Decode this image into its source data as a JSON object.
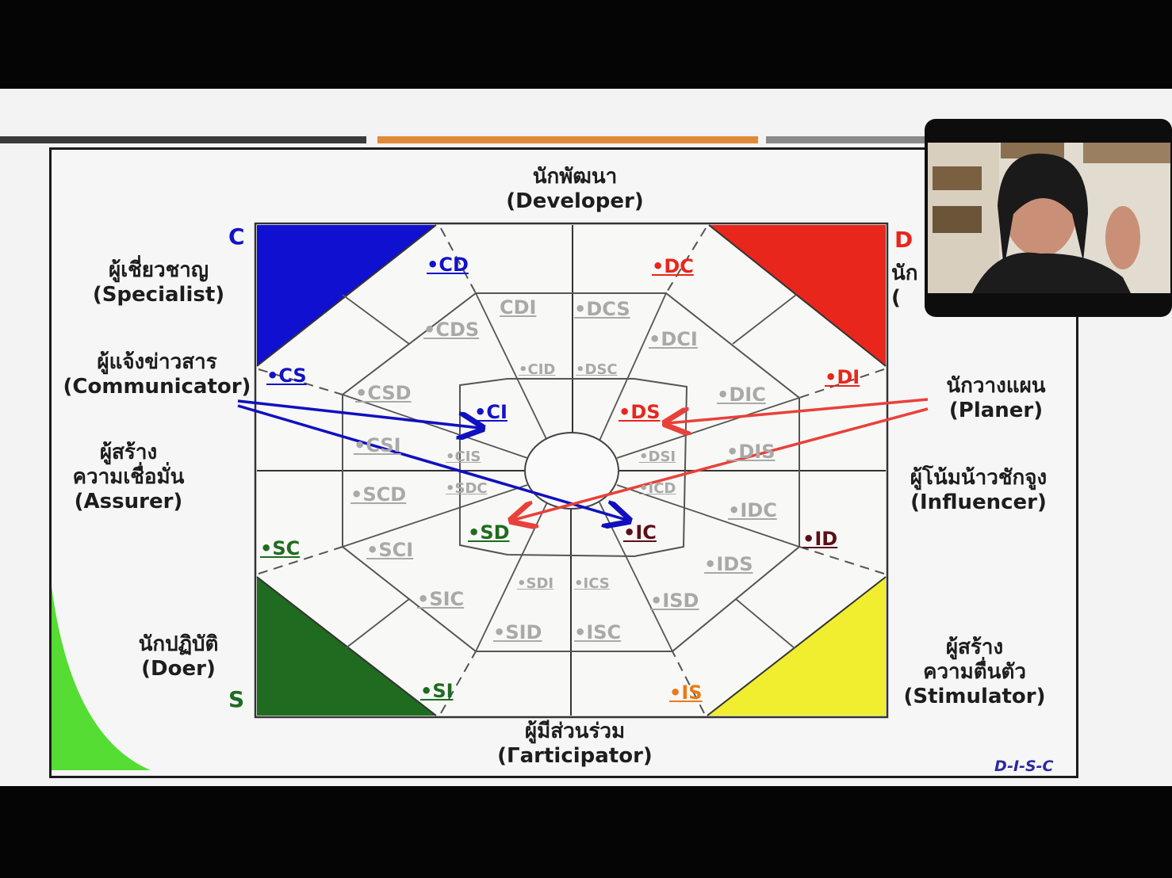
{
  "top_title": {
    "thai": "นักพัฒนา",
    "en": "(Developer)"
  },
  "bottom_title": {
    "thai": "ผู้มีส่วนร่วม",
    "en": "(Γarticipator)"
  },
  "corners": {
    "c": "C",
    "d": "D",
    "s": "S"
  },
  "left_labels": [
    {
      "thai": "ผู้เชี่ยวชาญ",
      "en": "(Specialist)"
    },
    {
      "thai": "ผู้แจ้งข่าวสาร",
      "en": "(Communicator)"
    },
    {
      "thai": "ผู้สร้าง",
      "thai2": "ความเชื่อมั่น",
      "en": "(Assurer)"
    },
    {
      "thai": "นักปฏิบัติ",
      "en": "(Doer)"
    }
  ],
  "right_labels": [
    {
      "thai": "นัก",
      "en": "("
    },
    {
      "thai": "นักวางแผน",
      "en": "(Planer)"
    },
    {
      "thai": "ผู้โน้มน้าวชักจูง",
      "en": "(Influencer)"
    },
    {
      "thai": "ผู้สร้าง",
      "thai2": "ความตื่นตัว",
      "en": "(Stimulator)"
    }
  ],
  "codes": {
    "cd": "•CD",
    "dc": "•DC",
    "cs": "•CS",
    "di": "•DI",
    "sc": "•SC",
    "id": "•ID",
    "si": "•SI",
    "is": "•IS",
    "ci": "•CI",
    "ds": "•DS",
    "sd": "•SD",
    "ic": "•IC",
    "cdi": "CDI",
    "dcs": "•DCS",
    "cds": "•CDS",
    "dci": "•DCI",
    "csd": "•CSD",
    "dic": "•DIC",
    "csi": "•CSI",
    "dis": "•DIS",
    "scd": "•SCD",
    "idc": "•IDC",
    "sci": "•SCI",
    "ids": "•IDS",
    "sic": "•SIC",
    "isd": "•ISD",
    "sid": "•SID",
    "isc": "•ISC",
    "cid": "•CID",
    "dsc": "•DSC",
    "cis": "•CIS",
    "dsi": "•DSI",
    "sdc": "•SDC",
    "icd": "•ICD",
    "sdi": "•SDI",
    "ics": "•ICS"
  },
  "footer": "D-I-S-C",
  "colors": {
    "c": "#1212c8",
    "d": "#e8261c",
    "s": "#1f6b1f",
    "i": "#f0ee2e",
    "muted": "#a9a9a9",
    "arrow_blue": "#1010c0",
    "arrow_red": "#e8413a"
  }
}
